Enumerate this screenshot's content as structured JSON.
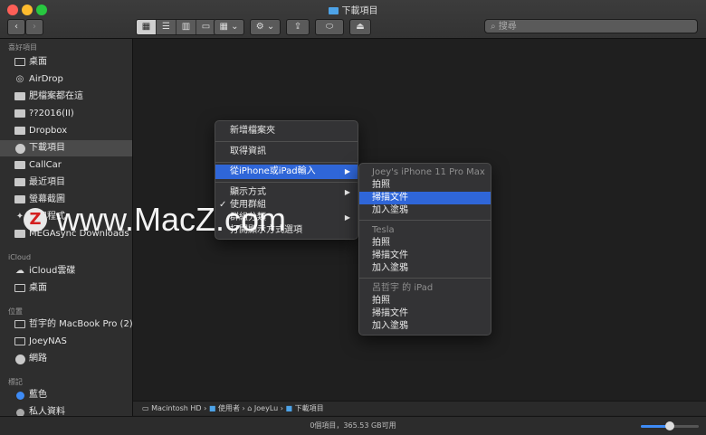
{
  "window": {
    "title": "下載項目"
  },
  "toolbar": {
    "back": "‹",
    "forward": "›",
    "search_placeholder": "搜尋"
  },
  "sidebar": {
    "favorites_label": "喜好項目",
    "favorites": [
      {
        "label": "桌面",
        "icon": "desktop-icon"
      },
      {
        "label": "AirDrop",
        "icon": "airdrop-icon"
      },
      {
        "label": "肥檔案都在這",
        "icon": "folder-icon"
      },
      {
        "label": "??2016(II)",
        "icon": "folder-icon"
      },
      {
        "label": "Dropbox",
        "icon": "folder-icon"
      },
      {
        "label": "下載項目",
        "icon": "download-icon",
        "selected": true
      },
      {
        "label": "CallCar",
        "icon": "folder-icon"
      },
      {
        "label": "最近項目",
        "icon": "clock-icon"
      },
      {
        "label": "螢幕截圖",
        "icon": "folder-icon"
      },
      {
        "label": "應用程式",
        "icon": "apps-icon"
      },
      {
        "label": "MEGAsync Downloads",
        "icon": "folder-icon"
      }
    ],
    "icloud_label": "iCloud",
    "icloud": [
      {
        "label": "iCloud雲碟",
        "icon": "cloud-icon"
      },
      {
        "label": "桌面",
        "icon": "desktop-icon"
      }
    ],
    "locations_label": "位置",
    "locations": [
      {
        "label": "哲宇的 MacBook Pro (2)",
        "icon": "laptop-icon"
      },
      {
        "label": "JoeyNAS",
        "icon": "server-icon"
      },
      {
        "label": "網路",
        "icon": "network-icon"
      }
    ],
    "tags_label": "標記",
    "tags": [
      {
        "label": "藍色",
        "color": "#3e8bf5"
      },
      {
        "label": "私人資料",
        "color": "#a8a8a8"
      }
    ]
  },
  "context_menu": {
    "items": [
      {
        "label": "新增檔案夾"
      },
      {
        "label": "取得資訊"
      },
      {
        "label": "從iPhone或iPad輸入",
        "submenu": true,
        "highlighted": true
      },
      {
        "label": "顯示方式",
        "submenu": true
      },
      {
        "label": "使用群組",
        "checked": true
      },
      {
        "label": "群組分類",
        "submenu": true
      },
      {
        "label": "打開顯示方式選項"
      }
    ]
  },
  "submenu": {
    "devices": [
      {
        "name": "Joey's iPhone 11 Pro Max",
        "actions": [
          "拍照",
          "掃描文件",
          "加入塗鴉"
        ],
        "highlighted_action": 1
      },
      {
        "name": "Tesla",
        "actions": [
          "拍照",
          "掃描文件",
          "加入塗鴉"
        ]
      },
      {
        "name": "呂哲宇 的 iPad",
        "actions": [
          "拍照",
          "掃描文件",
          "加入塗鴉"
        ]
      }
    ]
  },
  "pathbar": [
    "Macintosh HD",
    "使用者",
    "JoeyLu",
    "下載項目"
  ],
  "status": {
    "text": "0個項目，365.53 GB可用",
    "zoom": 0.5
  },
  "watermark": {
    "logo": "Z",
    "text": "www.MacZ.com"
  }
}
